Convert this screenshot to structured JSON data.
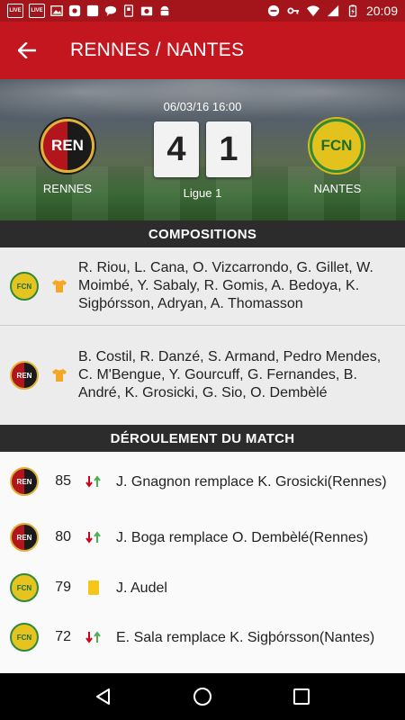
{
  "status_bar": {
    "time": "20:09",
    "left_icons": [
      "live-icon",
      "live-icon",
      "image-icon",
      "app-icon",
      "square-icon",
      "chat-icon",
      "card-icon",
      "photo-icon",
      "android-icon"
    ],
    "right_icons": [
      "do-not-disturb-icon",
      "key-icon",
      "wifi-icon",
      "signal-icon",
      "battery-charging-icon"
    ],
    "live_label": "LIVE"
  },
  "app_bar": {
    "title": "RENNES / NANTES"
  },
  "match": {
    "datetime": "06/03/16 16:00",
    "home": {
      "name": "RENNES",
      "short": "REN",
      "score": "4"
    },
    "away": {
      "name": "NANTES",
      "short": "FCN",
      "score": "1"
    },
    "league": "Ligue 1"
  },
  "sections": {
    "compositions": "COMPOSITIONS",
    "deroulement": "DÉROULEMENT DU MATCH"
  },
  "lineups": [
    {
      "team": "FCN",
      "players": "R. Riou, L. Cana, O. Vizcarrondo, G. Gillet, W. Moimbé, Y. Sabaly, R. Gomis, A. Bedoya, K. Sigþórsson, Adryan, A. Thomasson"
    },
    {
      "team": "REN",
      "players": "B. Costil, R. Danzé, S. Armand, Pedro Mendes, C. M'Bengue, Y. Gourcuff, G. Fernandes, B. André, K. Grosicki, G. Sio, O. Dembèlé"
    }
  ],
  "events": [
    {
      "team": "REN",
      "minute": "85",
      "type": "substitution",
      "text": "J. Gnagnon remplace K. Grosicki(Rennes)"
    },
    {
      "team": "REN",
      "minute": "80",
      "type": "substitution",
      "text": "J. Boga remplace O. Dembèlé(Rennes)"
    },
    {
      "team": "FCN",
      "minute": "79",
      "type": "yellow-card",
      "text": "J. Audel"
    },
    {
      "team": "FCN",
      "minute": "72",
      "type": "substitution",
      "text": "E. Sala remplace K. Sigþórsson(Nantes)"
    }
  ],
  "colors": {
    "primary": "#c3161e",
    "status_bar": "#a3141b",
    "section_header": "#2c2c2c",
    "yellow_card": "#f5c518"
  }
}
